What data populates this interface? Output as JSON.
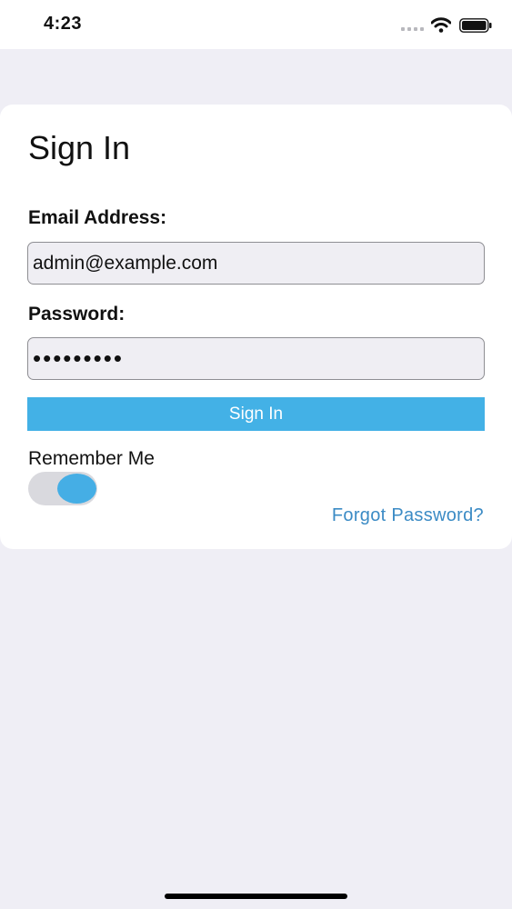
{
  "status_bar": {
    "time": "4:23",
    "icons": [
      "cellular-signal-icon",
      "wifi-icon",
      "battery-icon"
    ]
  },
  "form": {
    "title": "Sign In",
    "email_label": "Email Address:",
    "email_value": "admin@example.com",
    "password_label": "Password:",
    "password_value": "•••••••••",
    "sign_in_label": "Sign In",
    "remember_label": "Remember Me",
    "remember_on": true,
    "forgot_label": "Forgot Password?"
  },
  "colors": {
    "accent": "#43b1e6",
    "link": "#3b8bc5",
    "background": "#efeef5",
    "card": "#ffffff"
  }
}
